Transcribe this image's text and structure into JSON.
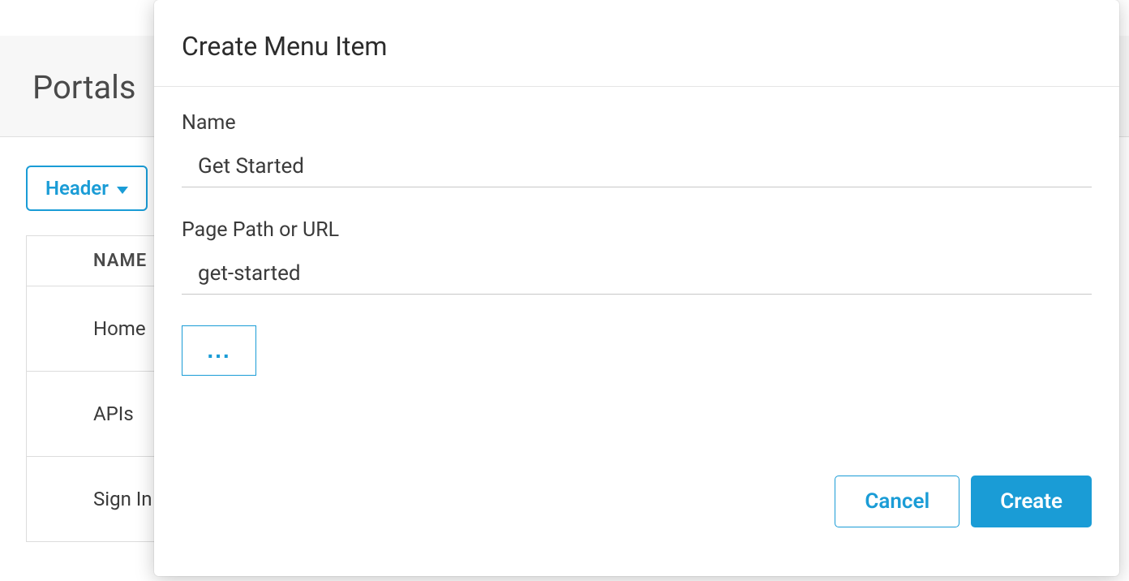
{
  "page": {
    "title": "Portals"
  },
  "dropdown": {
    "label": "Header"
  },
  "table": {
    "column_header": "NAME",
    "rows": [
      {
        "name": "Home"
      },
      {
        "name": "APIs"
      },
      {
        "name": "Sign In"
      }
    ]
  },
  "modal": {
    "title": "Create Menu Item",
    "name_label": "Name",
    "name_value": "Get Started",
    "path_label": "Page Path or URL",
    "path_value": "get-started",
    "more_label": "...",
    "cancel_label": "Cancel",
    "create_label": "Create"
  }
}
